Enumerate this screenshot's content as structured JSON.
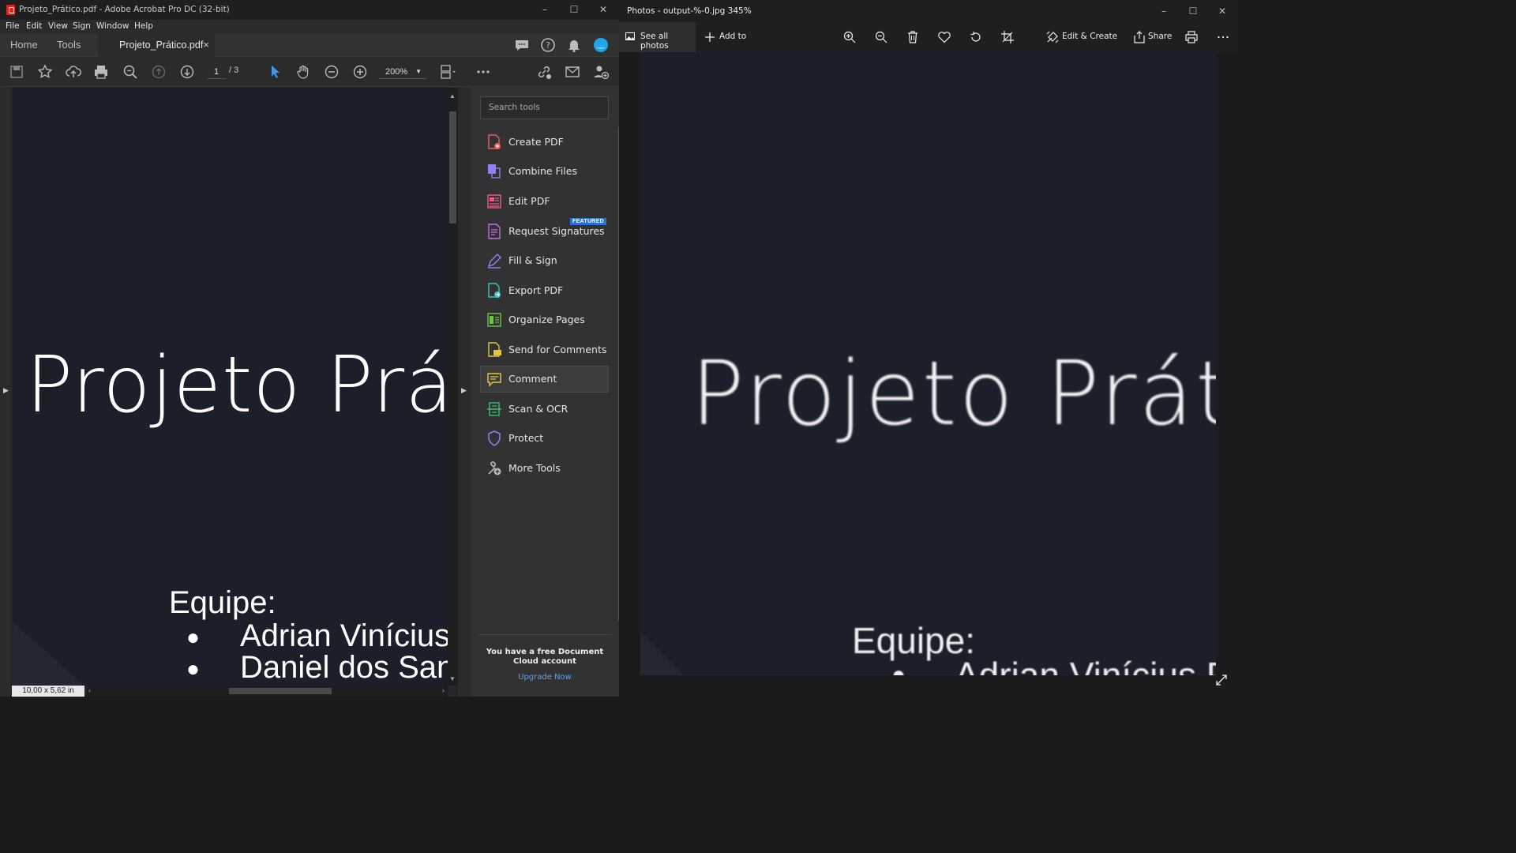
{
  "acrobat": {
    "window_title": "Projeto_Prático.pdf - Adobe Acrobat Pro DC (32-bit)",
    "menu": [
      "File",
      "Edit",
      "View",
      "Sign",
      "Window",
      "Help"
    ],
    "tabs": {
      "home": "Home",
      "tools": "Tools",
      "document": "Projeto_Prático.pdf",
      "close": "×"
    },
    "toolbar": {
      "current_page": "1",
      "total_pages": "/ 3",
      "zoom": "200%"
    },
    "document": {
      "title": "Projeto Prá",
      "equipe": "Equipe:",
      "members": [
        "Adrian Vinícius",
        "Daniel dos San"
      ],
      "page_size": "10,00 x 5,62 in"
    },
    "tools_pane": {
      "search_placeholder": "Search tools",
      "tools": [
        {
          "label": "Create PDF",
          "icon": "create-pdf-icon"
        },
        {
          "label": "Combine Files",
          "icon": "combine-files-icon"
        },
        {
          "label": "Edit PDF",
          "icon": "edit-pdf-icon"
        },
        {
          "label": "Request Signatures",
          "icon": "request-signatures-icon"
        },
        {
          "label": "Fill & Sign",
          "icon": "fill-sign-icon"
        },
        {
          "label": "Export PDF",
          "icon": "export-pdf-icon"
        },
        {
          "label": "Organize Pages",
          "icon": "organize-pages-icon"
        },
        {
          "label": "Send for Comments",
          "icon": "send-for-comments-icon"
        },
        {
          "label": "Comment",
          "icon": "comment-icon"
        },
        {
          "label": "Scan & OCR",
          "icon": "scan-ocr-icon"
        },
        {
          "label": "Protect",
          "icon": "protect-icon"
        },
        {
          "label": "More Tools",
          "icon": "more-tools-icon"
        }
      ],
      "featured_badge": "FEATURED",
      "cloud_message": "You have a free Document Cloud account",
      "upgrade_link": "Upgrade Now"
    }
  },
  "photos": {
    "window_title": "Photos - output-%-0.jpg   345%",
    "see_all": "See all photos",
    "add_to": "Add to",
    "edit_create": "Edit & Create",
    "share": "Share",
    "image": {
      "title": "Projeto Prát",
      "equipe": "Equipe:",
      "member": "Adrian Vinícius Pr"
    }
  },
  "colors": {
    "acrobat_bg": "#2b2b2b",
    "slide_bg": "#1a1f2a",
    "accent_blue": "#2d6fce",
    "link_blue": "#5aa2f0"
  }
}
